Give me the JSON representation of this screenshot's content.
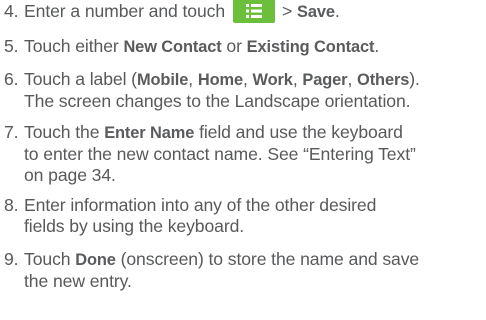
{
  "steps": [
    {
      "number": "4.",
      "text_before_icon": "Enter a number and touch",
      "icon": "menu-key-icon",
      "icon_color": "#6bbf3a",
      "gt": ">",
      "bold_save": "Save",
      "period": "."
    },
    {
      "number": "5.",
      "t1": "Touch either ",
      "b1": "New Contact",
      "t2": " or ",
      "b2": "Existing Contact",
      "t3": "."
    },
    {
      "number": "6.",
      "t1": "Touch a label (",
      "labels": [
        "Mobile",
        "Home",
        "Work",
        "Pager",
        "Others"
      ],
      "sep": ", ",
      "t2": ").",
      "line2": "The screen changes to the Landscape orientation."
    },
    {
      "number": "7.",
      "t1": "Touch the ",
      "b1": "Enter Name",
      "t2": " field and use the keyboard",
      "line2": "to enter the new contact name. See “Entering Text”",
      "line3": "on page 34."
    },
    {
      "number": "8.",
      "line1": "Enter information into any of the other desired",
      "line2": "fields by using the keyboard."
    },
    {
      "number": "9.",
      "t1": "Touch ",
      "b1": "Done",
      "t2": " (onscreen) to store the name and save",
      "line2": "the new entry."
    }
  ]
}
